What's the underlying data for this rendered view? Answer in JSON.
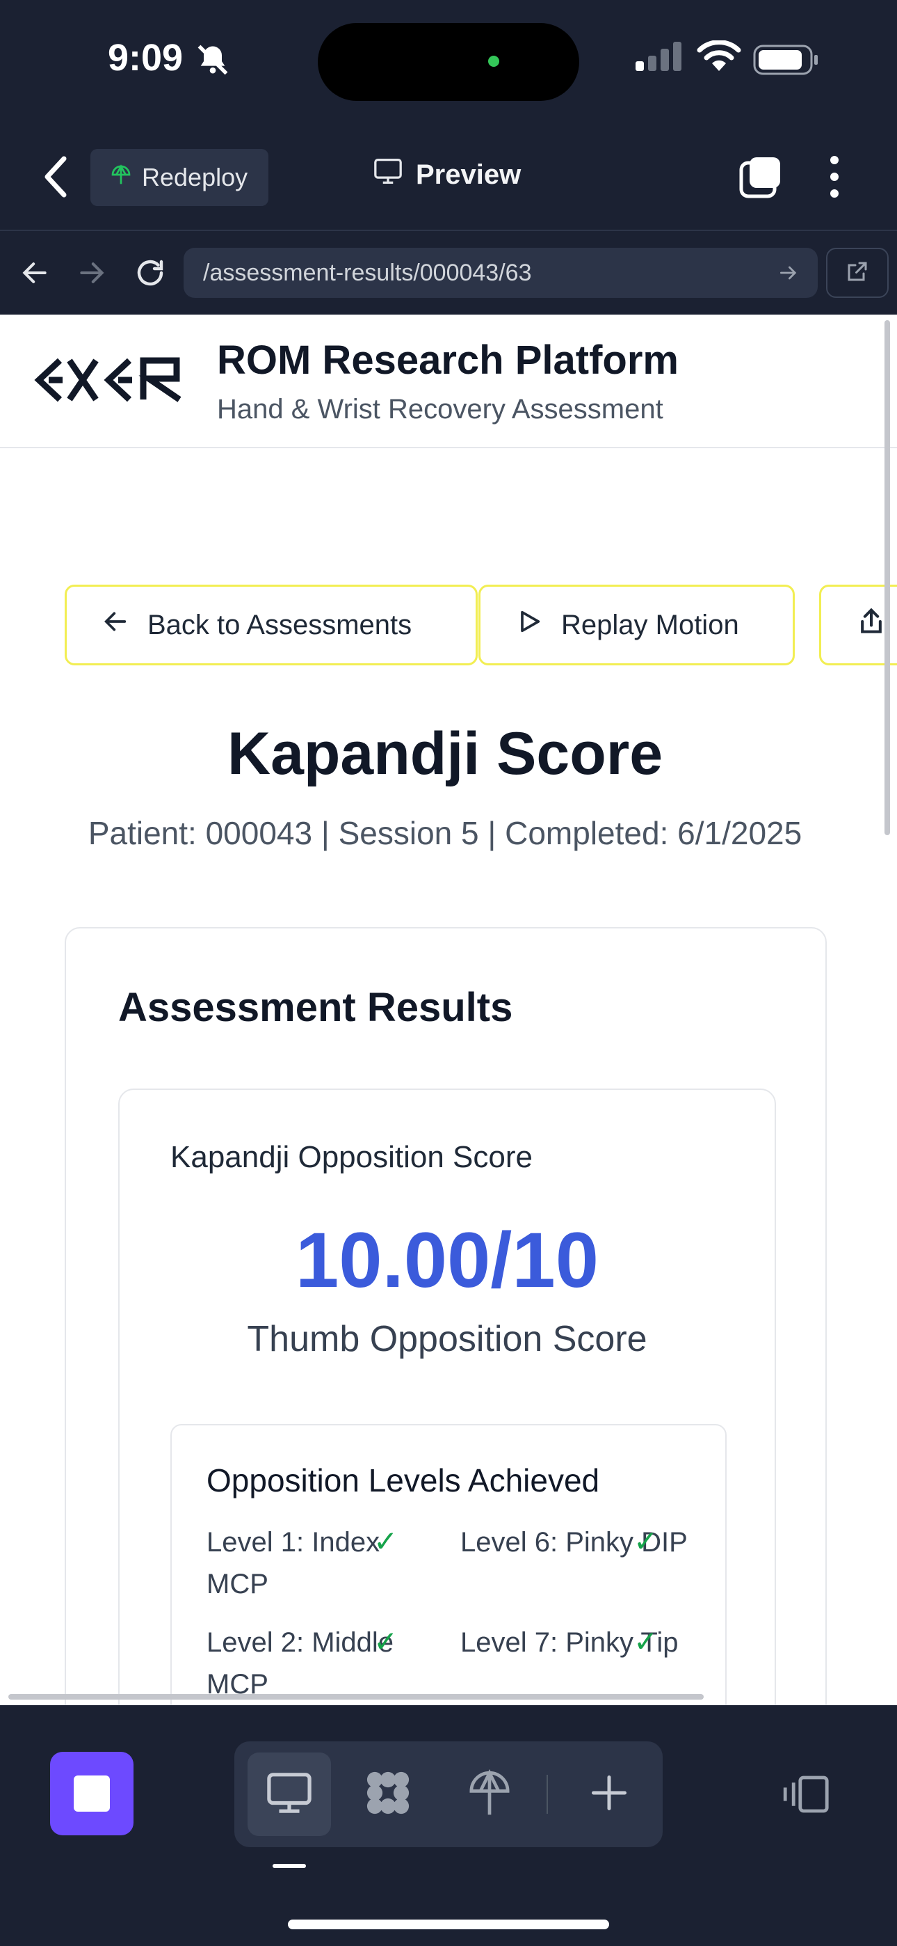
{
  "status_bar": {
    "time": "9:09"
  },
  "app_header": {
    "redeploy_label": "Redeploy",
    "preview_label": "Preview"
  },
  "browser": {
    "url": "/assessment-results/000043/63"
  },
  "site": {
    "title": "ROM Research Platform",
    "subtitle": "Hand & Wrist Recovery Assessment"
  },
  "actions": {
    "back_label": "Back to Assessments",
    "replay_label": "Replay Motion"
  },
  "page": {
    "title": "Kapandji Score",
    "meta": "Patient: 000043 | Session 5 | Completed: 6/1/2025"
  },
  "results": {
    "card_title": "Assessment Results",
    "score_title": "Kapandji Opposition Score",
    "score_value": "10.00/10",
    "score_caption": "Thumb Opposition Score",
    "levels_title": "Opposition Levels Achieved",
    "check_mark": "✓",
    "levels": [
      {
        "label": "Level 1: Index MCP",
        "achieved": true
      },
      {
        "label": "Level 6: Pinky DIP",
        "achieved": true
      },
      {
        "label": "Level 2: Middle MCP",
        "achieved": true
      },
      {
        "label": "Level 7: Pinky Tip",
        "achieved": true
      }
    ]
  },
  "colors": {
    "chrome_bg": "#1b2132",
    "accent_purple": "#6d4aff",
    "score_blue": "#3b5bdb",
    "button_border": "#f2ee53",
    "check_green": "#16a34a"
  }
}
